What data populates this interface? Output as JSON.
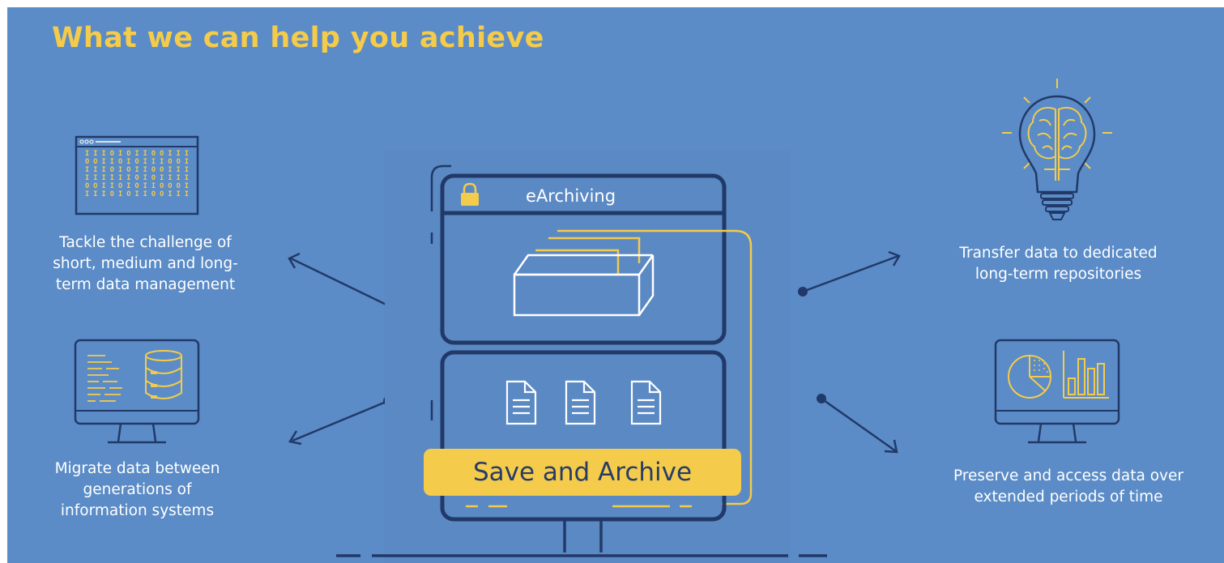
{
  "title": "What we can help you achieve",
  "central": {
    "window_title": "eArchiving",
    "action_button": "Save and Archive"
  },
  "benefits": [
    {
      "icon": "binary-data-window-icon",
      "text": [
        "Tackle the challenge of",
        "short, medium and long-",
        "term data management"
      ]
    },
    {
      "icon": "database-monitor-icon",
      "text": [
        "Migrate data between",
        "generations of",
        "information systems"
      ]
    },
    {
      "icon": "lightbulb-brain-icon",
      "text": [
        "Transfer data to dedicated",
        "long-term repositories"
      ]
    },
    {
      "icon": "analytics-monitor-icon",
      "text": [
        "Preserve and access data over",
        "extended periods of time"
      ]
    }
  ],
  "colors": {
    "background": "#5b8cc7",
    "accent": "#f4cb4a",
    "dark_navy": "#213968",
    "text": "#ffffff"
  }
}
